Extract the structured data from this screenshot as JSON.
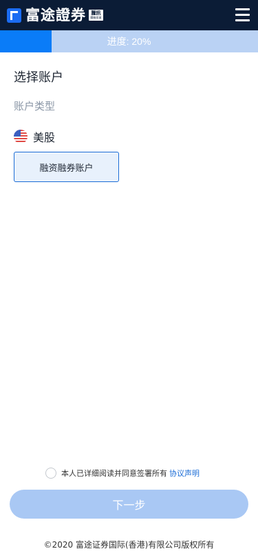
{
  "header": {
    "brand_name": "富途證券",
    "badge_top": "騰訊",
    "badge_bottom": "戰略投資"
  },
  "progress": {
    "label": "进度: 20%",
    "value": 0.2
  },
  "page_title": "选择账户",
  "account_type_label": "账户类型",
  "market": {
    "label": "美股",
    "flag_icon": "us-flag-icon"
  },
  "account_options": [
    {
      "label": "融资融券账户",
      "selected": true
    }
  ],
  "agreement": {
    "text": "本人已详细阅读并同意签署所有",
    "link_text": "协议声明",
    "checked": false
  },
  "next_button_label": "下一步",
  "footer_text": "©2020 富途证券国际(香港)有限公司版权所有",
  "colors": {
    "header_bg": "#0b1c36",
    "brand_blue": "#1b6cf2",
    "progress_fill": "#0a7cf8",
    "progress_track": "#bad2f4",
    "button_disabled": "#a9c8f4",
    "link": "#1b6cd6"
  }
}
